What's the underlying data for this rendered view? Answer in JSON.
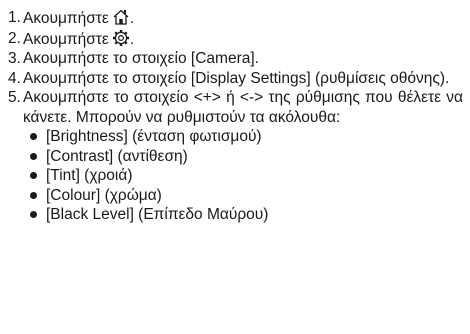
{
  "steps": [
    {
      "number": "1.",
      "text": "Ακουμπήστε",
      "icon": "home-icon",
      "suffix": "."
    },
    {
      "number": "2.",
      "text": "Ακουμπήστε",
      "icon": "gear-icon",
      "suffix": "."
    },
    {
      "number": "3.",
      "text": "Ακουμπήστε το στοιχείο [Camera]."
    },
    {
      "number": "4.",
      "text": "Ακουμπήστε το στοιχείο [Display Settings] (ρυθμίσεις οθόνης)."
    },
    {
      "number": "5.",
      "text": "Ακουμπήστε το στοιχείο <+> ή <-> της ρύθμισης που θέλετε να κάνετε. Μπορούν να ρυθμιστούν τα ακόλουθα:"
    }
  ],
  "settings": [
    "[Brightness] (ένταση φωτισμού)",
    "[Contrast] (αντίθεση)",
    "[Tint] (χροιά)",
    "[Colour] (χρώμα)",
    "[Black Level] (Επίπεδο Μαύρου)"
  ]
}
